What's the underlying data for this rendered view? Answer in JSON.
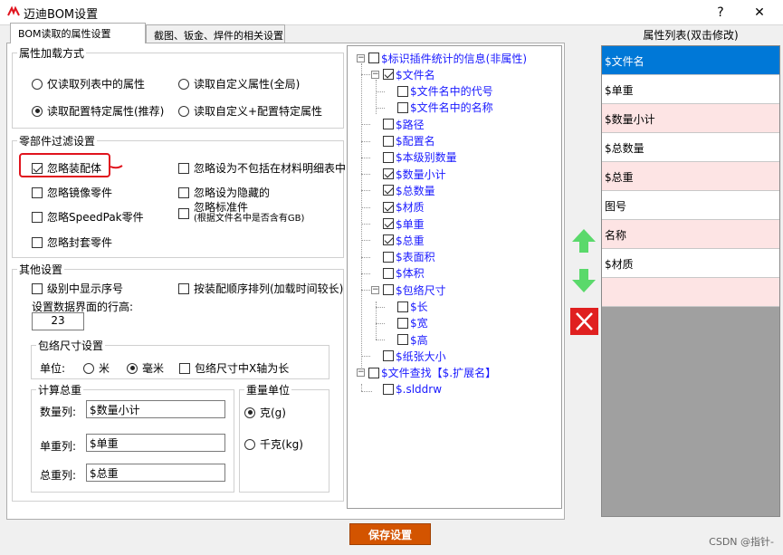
{
  "window": {
    "title": "迈迪BOM设置",
    "help_label": "?",
    "close_label": "✕"
  },
  "tabs": [
    {
      "label": "BOM读取的属性设置"
    },
    {
      "label": "截图、钣金、焊件的相关设置"
    }
  ],
  "load_mode": {
    "title": "属性加载方式",
    "options": [
      {
        "label": "仅读取列表中的属性",
        "checked": false
      },
      {
        "label": "读取自定义属性(全局)",
        "checked": false
      },
      {
        "label": "读取配置特定属性(推荐)",
        "checked": true
      },
      {
        "label": "读取自定义+配置特定属性",
        "checked": false
      }
    ]
  },
  "filter": {
    "title": "零部件过滤设置",
    "ignore_assembly": {
      "label": "忽略装配体",
      "checked": true
    },
    "ignore_mirror": {
      "label": "忽略镜像零件",
      "checked": false
    },
    "ignore_speedpak": {
      "label": "忽略SpeedPak零件",
      "checked": false
    },
    "ignore_envelope": {
      "label": "忽略封套零件",
      "checked": false
    },
    "ignore_not_in_bom": {
      "label": "忽略设为不包括在材料明细表中的",
      "checked": false
    },
    "ignore_hidden": {
      "label": "忽略设为隐藏的",
      "checked": false
    },
    "ignore_standard": {
      "label": "忽略标准件",
      "sublabel": "(根据文件名中是否含有GB)",
      "checked": false
    }
  },
  "other": {
    "title": "其他设置",
    "show_level_no": {
      "label": "级别中显示序号",
      "checked": false
    },
    "sort_by_assembly": {
      "label": "按装配顺序排列(加载时间较长)",
      "checked": false
    },
    "row_height_label": "设置数据界面的行高:",
    "row_height_value": "23",
    "bbox": {
      "title": "包络尺寸设置",
      "unit_label": "单位:",
      "unit_m": {
        "label": "米",
        "checked": false
      },
      "unit_mm": {
        "label": "毫米",
        "checked": true
      },
      "x_long": {
        "label": "包络尺寸中X轴为长",
        "checked": false
      }
    },
    "weight": {
      "title": "计算总重",
      "qty_label": "数量列:",
      "qty_value": "$数量小计",
      "unit_label": "单重列:",
      "unit_value": "$单重",
      "total_label": "总重列:",
      "total_value": "$总重"
    },
    "weight_unit": {
      "title": "重量单位",
      "gram": {
        "label": "克(g)",
        "checked": true
      },
      "kg": {
        "label": "千克(kg)",
        "checked": false
      }
    }
  },
  "tree": {
    "root1": {
      "label": "$标识插件统计的信息(非属性)",
      "checked": false
    },
    "items": [
      {
        "label": "$文件名",
        "checked": true,
        "level": 2,
        "expander": true
      },
      {
        "label": "$文件名中的代号",
        "checked": false,
        "level": 3
      },
      {
        "label": "$文件名中的名称",
        "checked": false,
        "level": 3
      },
      {
        "label": "$路径",
        "checked": false,
        "level": 2
      },
      {
        "label": "$配置名",
        "checked": false,
        "level": 2
      },
      {
        "label": "$本级别数量",
        "checked": false,
        "level": 2
      },
      {
        "label": "$数量小计",
        "checked": true,
        "level": 2
      },
      {
        "label": "$总数量",
        "checked": true,
        "level": 2
      },
      {
        "label": "$材质",
        "checked": true,
        "level": 2
      },
      {
        "label": "$单重",
        "checked": true,
        "level": 2
      },
      {
        "label": "$总重",
        "checked": true,
        "level": 2
      },
      {
        "label": "$表面积",
        "checked": false,
        "level": 2
      },
      {
        "label": "$体积",
        "checked": false,
        "level": 2
      },
      {
        "label": "$包络尺寸",
        "checked": false,
        "level": 2,
        "expander": true
      },
      {
        "label": "$长",
        "checked": false,
        "level": 3
      },
      {
        "label": "$宽",
        "checked": false,
        "level": 3
      },
      {
        "label": "$高",
        "checked": false,
        "level": 3
      },
      {
        "label": "$纸张大小",
        "checked": false,
        "level": 2
      }
    ],
    "root2": {
      "label": "$文件查找【$.扩展名】",
      "checked": false
    },
    "root2_child": {
      "label": "$.slddrw",
      "checked": false
    }
  },
  "property_list": {
    "title": "属性列表(双击修改)",
    "rows": [
      {
        "label": "$文件名",
        "style": "sel"
      },
      {
        "label": "$单重",
        "style": "white"
      },
      {
        "label": "$数量小计",
        "style": "pink"
      },
      {
        "label": "$总数量",
        "style": "white"
      },
      {
        "label": "$总重",
        "style": "pink"
      },
      {
        "label": "图号",
        "style": "white"
      },
      {
        "label": "名称",
        "style": "pink"
      },
      {
        "label": "$材质",
        "style": "white"
      },
      {
        "label": "",
        "style": "pink"
      }
    ]
  },
  "buttons": {
    "save_label": "保存设置"
  },
  "watermark": "CSDN @指针-",
  "colors": {
    "accent": "#0078d7",
    "save": "#d35400",
    "delete": "#e02020",
    "arrow": "#4cd964",
    "tree_text": "#1a1aff"
  }
}
